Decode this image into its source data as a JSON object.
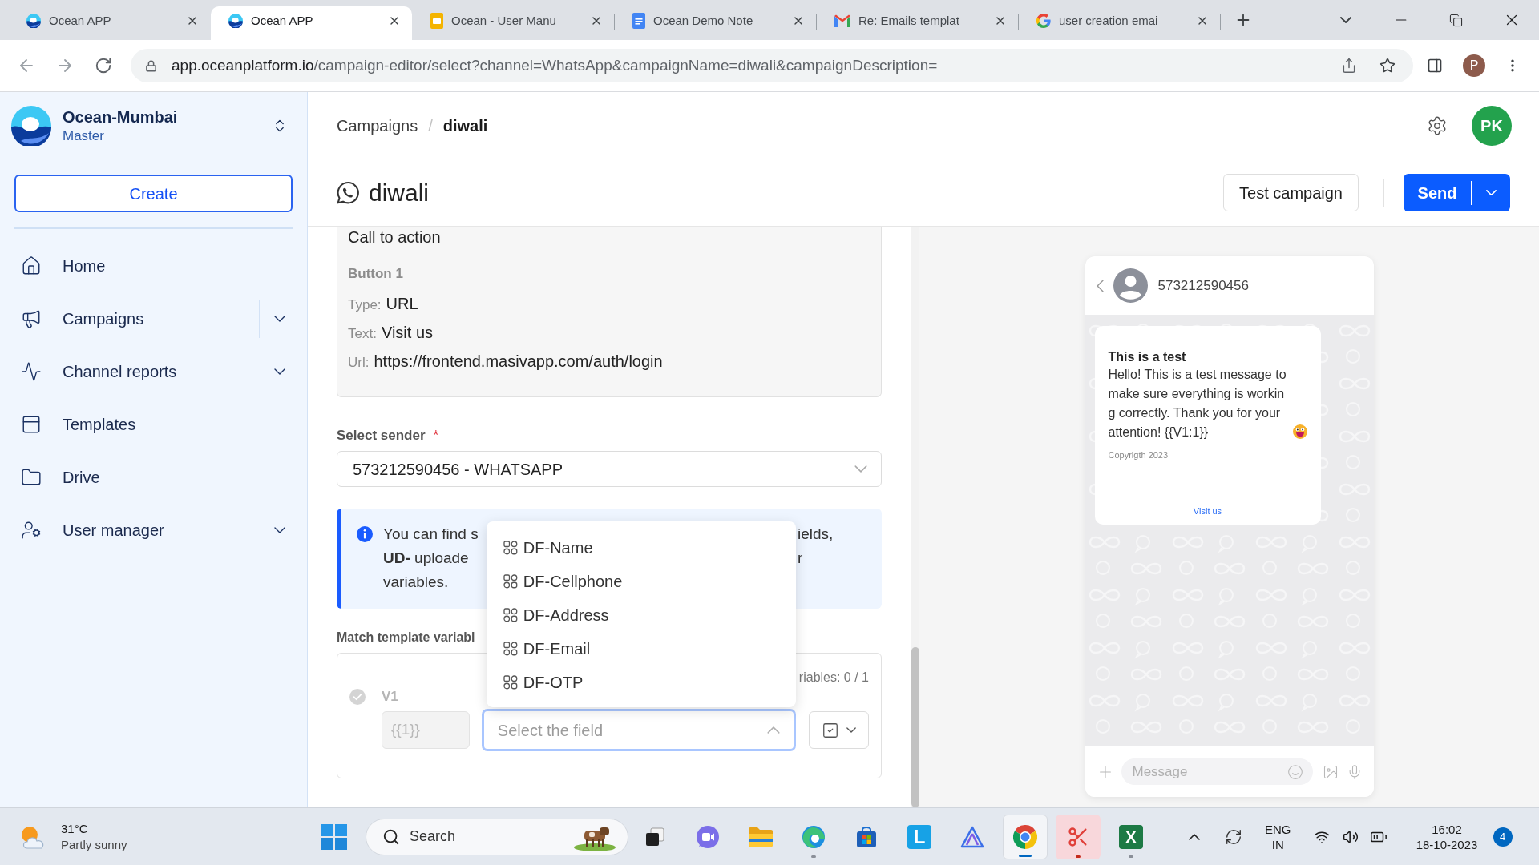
{
  "browser": {
    "tabs": [
      {
        "title": "Ocean APP",
        "selected": false
      },
      {
        "title": "Ocean APP",
        "selected": true
      },
      {
        "title": "Ocean - User Manu",
        "selected": false
      },
      {
        "title": "Ocean Demo Note",
        "selected": false
      },
      {
        "title": "Re: Emails templat",
        "selected": false
      },
      {
        "title": "user creation emai",
        "selected": false
      }
    ],
    "address": {
      "domain": "app.oceanplatform.io",
      "path": "/campaign-editor/select?channel=WhatsApp&campaignName=diwali&campaignDescription="
    },
    "profile": "P"
  },
  "sidebar": {
    "workspace": {
      "name": "Ocean-Mumbai",
      "role": "Master"
    },
    "create_button": "Create",
    "items": [
      {
        "label": "Home",
        "expandable": false,
        "split": false
      },
      {
        "label": "Campaigns",
        "expandable": true,
        "split": true
      },
      {
        "label": "Channel reports",
        "expandable": true,
        "split": false
      },
      {
        "label": "Templates",
        "expandable": false,
        "split": false
      },
      {
        "label": "Drive",
        "expandable": false,
        "split": false
      },
      {
        "label": "User manager",
        "expandable": true,
        "split": false
      }
    ]
  },
  "header": {
    "breadcrumbs": [
      "Campaigns",
      "diwali"
    ],
    "separator": "/",
    "avatar": "PK"
  },
  "campaign_bar": {
    "title": "diwali",
    "test_button": "Test campaign",
    "send_button": "Send"
  },
  "template_card": {
    "heading": "Call to action",
    "button_title": "Button 1",
    "fields": [
      {
        "label": "Type:",
        "value": "URL"
      },
      {
        "label": "Text:",
        "value": "Visit us"
      },
      {
        "label": "Url:",
        "value": "https://frontend.masivapp.com/auth/login"
      }
    ]
  },
  "sender": {
    "label": "Select sender",
    "required_mark": "*",
    "value": "573212590456 - WHATSAPP"
  },
  "info_alert": {
    "lines": [
      {
        "left": "You can find s",
        "right": "ields,"
      },
      {
        "left": "**UD-** uploade",
        "right": "r"
      },
      {
        "left": "variables."
      }
    ]
  },
  "variables": {
    "label": "Match template variabl",
    "counter": "riables: 0 / 1",
    "rows": [
      {
        "name": "V1",
        "matched": false,
        "token": {
          "value": "{{1}}",
          "disabled": true
        },
        "field": {
          "placeholder": "Select the field",
          "open": true,
          "options": [
            "DF-Name",
            "DF-Cellphone",
            "DF-Address",
            "DF-Email",
            "DF-OTP"
          ]
        }
      }
    ]
  },
  "preview": {
    "contact": "573212590456",
    "message": {
      "title": "This is a test",
      "body": "Hello! This is a test message to make sure everything is working correctly. Thank you for your attention! {{V1:1}}",
      "footer": "Copyrigth 2023",
      "button": "Visit us"
    },
    "composer": {
      "placeholder": "Message"
    }
  },
  "taskbar": {
    "weather": {
      "temperature": "31°C",
      "condition": "Partly sunny"
    },
    "search": {
      "label": "Search"
    },
    "apps": [
      {
        "running": false,
        "selected": false,
        "attention": false
      },
      {
        "running": false,
        "selected": false,
        "attention": false
      },
      {
        "running": false,
        "selected": false,
        "attention": false
      },
      {
        "running": true,
        "selected": false,
        "attention": false
      },
      {
        "running": false,
        "selected": false,
        "attention": false
      },
      {
        "running": false,
        "selected": false,
        "attention": false,
        "glyph": "L"
      },
      {
        "running": false,
        "selected": false,
        "attention": false
      },
      {
        "running": true,
        "selected": true,
        "attention": false
      },
      {
        "running": true,
        "selected": false,
        "attention": true
      },
      {
        "running": true,
        "selected": false,
        "attention": false,
        "glyph": "X"
      }
    ],
    "tray": {
      "language": "ENG",
      "region": "IN",
      "time": "16:02",
      "date": "18-10-2023",
      "notifications": "4"
    }
  }
}
